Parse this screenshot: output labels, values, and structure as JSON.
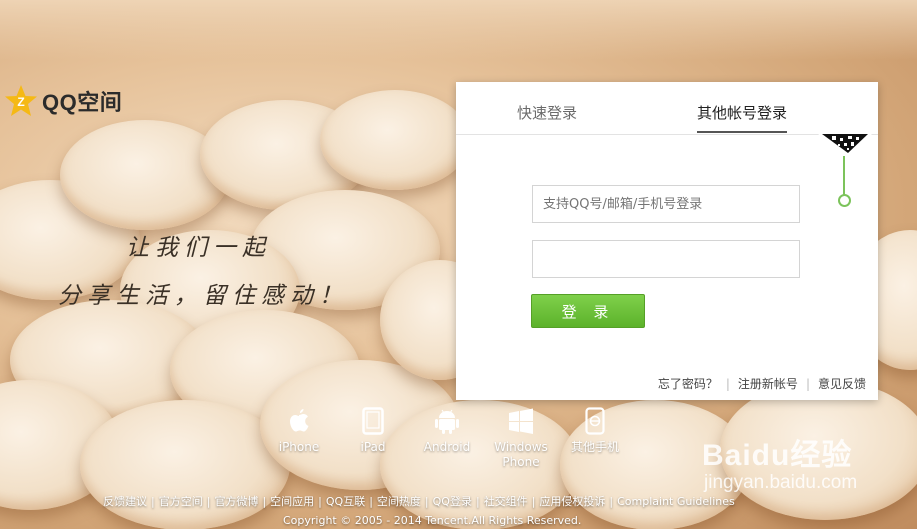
{
  "logo": {
    "text": "QQ空间",
    "icon": "qzone-star-icon"
  },
  "slogan": {
    "line1": "让我们一起",
    "line2": "分享生活，留住感动！"
  },
  "login": {
    "tabs": [
      {
        "label": "快速登录"
      },
      {
        "label": "其他帐号登录",
        "active": true
      }
    ],
    "username_placeholder": "支持QQ号/邮箱/手机号登录",
    "password_placeholder": "",
    "submit_label": "登 录",
    "links": [
      "忘了密码？",
      "注册新帐号",
      "意见反馈"
    ],
    "accent_color": "#6cc13a"
  },
  "devices": [
    {
      "label": "iPhone",
      "icon": "apple-icon"
    },
    {
      "label": "iPad",
      "icon": "tablet-icon"
    },
    {
      "label": "Android",
      "icon": "android-icon"
    },
    {
      "label": "Windows Phone",
      "icon": "windows-icon"
    },
    {
      "label": "其他手机",
      "icon": "other-phone-icon"
    }
  ],
  "footer": {
    "links": [
      "反馈建议",
      "官方空间",
      "官方微博",
      "空间应用",
      "QQ互联",
      "空间热度",
      "QQ登录",
      "社交组件",
      "应用侵权投诉",
      "Complaint Guidelines"
    ],
    "copyright": "Copyright © 2005 - 2014 Tencent.All Rights Reserved."
  },
  "watermark": {
    "main": "Baidu经验",
    "sub": "jingyan.baidu.com"
  }
}
